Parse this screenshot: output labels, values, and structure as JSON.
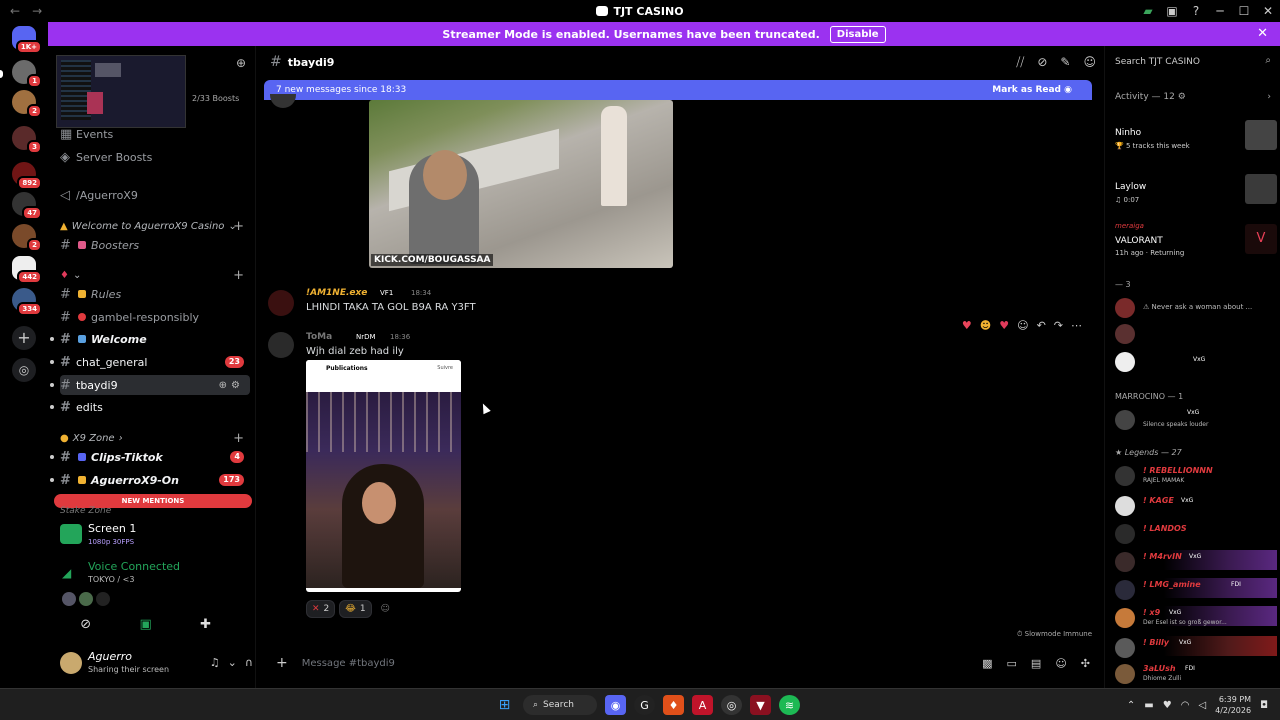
{
  "titlebar": {
    "title": "TJT CASINO",
    "back_icon": "←",
    "forward_icon": "→",
    "minimize": "─",
    "maximize": "☐",
    "close": "✕"
  },
  "banner": {
    "text": "Streamer Mode is enabled. Usernames have been truncated.",
    "disable_label": "Disable",
    "close_icon": "✕"
  },
  "rail": {
    "badges": [
      "1K+",
      "1",
      "2",
      "3",
      "892",
      "47",
      "2",
      "442",
      "334"
    ]
  },
  "sidebar": {
    "boosts": "2/33 Boosts",
    "items": [
      {
        "label": "Events"
      },
      {
        "label": "Server Boosts"
      },
      {
        "label": "/AguerroX9"
      }
    ],
    "category_welcome": "Welcome to AguerroX9 Casino",
    "channels": [
      {
        "label": "Boosters"
      },
      {
        "label": "Rules"
      },
      {
        "label": "gambel-responsibly"
      },
      {
        "label": "Welcome"
      },
      {
        "label": "chat_general",
        "count": "23"
      },
      {
        "label": "tbaydi9"
      },
      {
        "label": "edits"
      }
    ],
    "category_x9": "X9 Zone",
    "channels_x9": [
      {
        "label": "Clips-Tiktok",
        "count": "4"
      },
      {
        "label": "AguerroX9-On",
        "count": "173"
      }
    ],
    "new_mentions": "NEW MENTIONS",
    "stake_zone": "Stake Zone"
  },
  "screen_panel": {
    "title": "Screen 1",
    "quality": "1080p 30FPS"
  },
  "voice": {
    "status": "Voice Connected",
    "channel": "TOKYO / <3"
  },
  "user": {
    "name": "Aguerro",
    "status": "Sharing their screen"
  },
  "chat": {
    "channel": "tbaydi9",
    "new_messages": "7 new messages since 18:33",
    "mark_read": "Mark as Read",
    "video_caption": "KICK.COM/BOUGASSAA",
    "msg1": {
      "author": "!AM1NE.exe",
      "tag": "VF1",
      "time": "18:34",
      "text": "LHINDI TAKA TA GOL B9A RA Y3FT"
    },
    "msg2": {
      "author": "ToMa",
      "tag": "NrDM",
      "time": "18:36",
      "text": "Wjh dial zeb had ily",
      "image_header": "Publications",
      "image_follow": "Suivre"
    },
    "reactions": [
      {
        "emoji": "✕",
        "count": "2"
      },
      {
        "emoji": "😂",
        "count": "1"
      }
    ],
    "slowmode": "Slowmode Immune",
    "placeholder": "Message #tbaydi9"
  },
  "right": {
    "search_placeholder": "Search TJT CASINO",
    "activity_header": "Activity — 12",
    "activities": [
      {
        "name": "Ninho",
        "sub": "5 tracks this week"
      },
      {
        "name": "Laylow",
        "sub": "0:07"
      },
      {
        "name": "VALORANT",
        "sub": "11h ago · Returning",
        "user": "meraiga"
      }
    ],
    "group1": "— 3",
    "group1_members": [
      {
        "status": "Never ask a woman about ..."
      },
      {
        "status": ""
      },
      {
        "tag": "VxG"
      }
    ],
    "group2": "MARROCINO — 1",
    "group2_member": {
      "tag": "VxG",
      "status": "Silence speaks louder"
    },
    "group3": "Legends — 27",
    "legends": [
      {
        "name": "! REBELLIONNN",
        "status": "RAJEL MAMAK"
      },
      {
        "name": "! KAGE",
        "tag": "VxG"
      },
      {
        "name": "! LANDOS"
      },
      {
        "name": "! M4rvIN",
        "tag": "VxG"
      },
      {
        "name": "! LMG_amine",
        "tag": "FDI"
      },
      {
        "name": "! x9",
        "tag": "VxG",
        "status": "Der Esel ist so groß gewor..."
      },
      {
        "name": "! Billy",
        "tag": "VxG"
      },
      {
        "name": "3aLUsh",
        "tag": "FDI",
        "status": "Dhiome Zulli"
      }
    ]
  },
  "taskbar": {
    "search": "Search",
    "time": "6:39 PM",
    "date": "4/2/2026"
  }
}
